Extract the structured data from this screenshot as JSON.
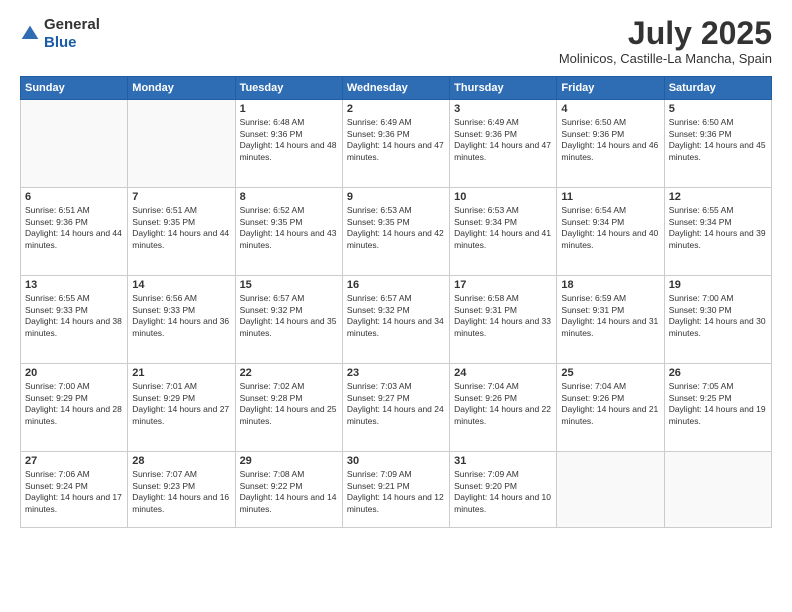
{
  "header": {
    "logo_general": "General",
    "logo_blue": "Blue",
    "title": "July 2025",
    "subtitle": "Molinicos, Castille-La Mancha, Spain"
  },
  "days_of_week": [
    "Sunday",
    "Monday",
    "Tuesday",
    "Wednesday",
    "Thursday",
    "Friday",
    "Saturday"
  ],
  "weeks": [
    [
      {
        "day": "",
        "content": ""
      },
      {
        "day": "",
        "content": ""
      },
      {
        "day": "1",
        "content": "Sunrise: 6:48 AM\nSunset: 9:36 PM\nDaylight: 14 hours and 48 minutes."
      },
      {
        "day": "2",
        "content": "Sunrise: 6:49 AM\nSunset: 9:36 PM\nDaylight: 14 hours and 47 minutes."
      },
      {
        "day": "3",
        "content": "Sunrise: 6:49 AM\nSunset: 9:36 PM\nDaylight: 14 hours and 47 minutes."
      },
      {
        "day": "4",
        "content": "Sunrise: 6:50 AM\nSunset: 9:36 PM\nDaylight: 14 hours and 46 minutes."
      },
      {
        "day": "5",
        "content": "Sunrise: 6:50 AM\nSunset: 9:36 PM\nDaylight: 14 hours and 45 minutes."
      }
    ],
    [
      {
        "day": "6",
        "content": "Sunrise: 6:51 AM\nSunset: 9:36 PM\nDaylight: 14 hours and 44 minutes."
      },
      {
        "day": "7",
        "content": "Sunrise: 6:51 AM\nSunset: 9:35 PM\nDaylight: 14 hours and 44 minutes."
      },
      {
        "day": "8",
        "content": "Sunrise: 6:52 AM\nSunset: 9:35 PM\nDaylight: 14 hours and 43 minutes."
      },
      {
        "day": "9",
        "content": "Sunrise: 6:53 AM\nSunset: 9:35 PM\nDaylight: 14 hours and 42 minutes."
      },
      {
        "day": "10",
        "content": "Sunrise: 6:53 AM\nSunset: 9:34 PM\nDaylight: 14 hours and 41 minutes."
      },
      {
        "day": "11",
        "content": "Sunrise: 6:54 AM\nSunset: 9:34 PM\nDaylight: 14 hours and 40 minutes."
      },
      {
        "day": "12",
        "content": "Sunrise: 6:55 AM\nSunset: 9:34 PM\nDaylight: 14 hours and 39 minutes."
      }
    ],
    [
      {
        "day": "13",
        "content": "Sunrise: 6:55 AM\nSunset: 9:33 PM\nDaylight: 14 hours and 38 minutes."
      },
      {
        "day": "14",
        "content": "Sunrise: 6:56 AM\nSunset: 9:33 PM\nDaylight: 14 hours and 36 minutes."
      },
      {
        "day": "15",
        "content": "Sunrise: 6:57 AM\nSunset: 9:32 PM\nDaylight: 14 hours and 35 minutes."
      },
      {
        "day": "16",
        "content": "Sunrise: 6:57 AM\nSunset: 9:32 PM\nDaylight: 14 hours and 34 minutes."
      },
      {
        "day": "17",
        "content": "Sunrise: 6:58 AM\nSunset: 9:31 PM\nDaylight: 14 hours and 33 minutes."
      },
      {
        "day": "18",
        "content": "Sunrise: 6:59 AM\nSunset: 9:31 PM\nDaylight: 14 hours and 31 minutes."
      },
      {
        "day": "19",
        "content": "Sunrise: 7:00 AM\nSunset: 9:30 PM\nDaylight: 14 hours and 30 minutes."
      }
    ],
    [
      {
        "day": "20",
        "content": "Sunrise: 7:00 AM\nSunset: 9:29 PM\nDaylight: 14 hours and 28 minutes."
      },
      {
        "day": "21",
        "content": "Sunrise: 7:01 AM\nSunset: 9:29 PM\nDaylight: 14 hours and 27 minutes."
      },
      {
        "day": "22",
        "content": "Sunrise: 7:02 AM\nSunset: 9:28 PM\nDaylight: 14 hours and 25 minutes."
      },
      {
        "day": "23",
        "content": "Sunrise: 7:03 AM\nSunset: 9:27 PM\nDaylight: 14 hours and 24 minutes."
      },
      {
        "day": "24",
        "content": "Sunrise: 7:04 AM\nSunset: 9:26 PM\nDaylight: 14 hours and 22 minutes."
      },
      {
        "day": "25",
        "content": "Sunrise: 7:04 AM\nSunset: 9:26 PM\nDaylight: 14 hours and 21 minutes."
      },
      {
        "day": "26",
        "content": "Sunrise: 7:05 AM\nSunset: 9:25 PM\nDaylight: 14 hours and 19 minutes."
      }
    ],
    [
      {
        "day": "27",
        "content": "Sunrise: 7:06 AM\nSunset: 9:24 PM\nDaylight: 14 hours and 17 minutes."
      },
      {
        "day": "28",
        "content": "Sunrise: 7:07 AM\nSunset: 9:23 PM\nDaylight: 14 hours and 16 minutes."
      },
      {
        "day": "29",
        "content": "Sunrise: 7:08 AM\nSunset: 9:22 PM\nDaylight: 14 hours and 14 minutes."
      },
      {
        "day": "30",
        "content": "Sunrise: 7:09 AM\nSunset: 9:21 PM\nDaylight: 14 hours and 12 minutes."
      },
      {
        "day": "31",
        "content": "Sunrise: 7:09 AM\nSunset: 9:20 PM\nDaylight: 14 hours and 10 minutes."
      },
      {
        "day": "",
        "content": ""
      },
      {
        "day": "",
        "content": ""
      }
    ]
  ]
}
